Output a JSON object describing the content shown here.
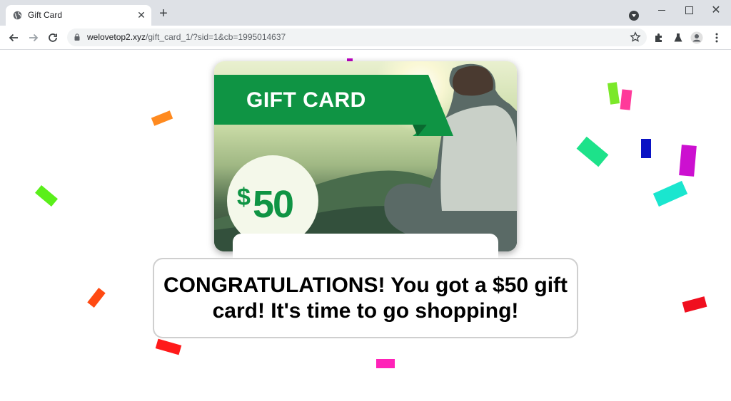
{
  "browser": {
    "tab_title": "Gift Card",
    "url_domain": "welovetop2.xyz",
    "url_path": "/gift_card_1/?sid=1&cb=1995014637"
  },
  "icons": {
    "favicon": "globe-icon",
    "tab_close": "close-icon",
    "new_tab": "plus-icon",
    "tab_search": "chevron-down-icon",
    "back": "arrow-left-icon",
    "forward": "arrow-right-icon",
    "reload": "reload-icon",
    "lock": "lock-icon",
    "bookmark": "star-icon",
    "extensions": "puzzle-icon",
    "labs": "flask-icon",
    "profile": "person-icon",
    "menu": "kebab-menu-icon"
  },
  "gift_card": {
    "banner_text": "GIFT CARD",
    "currency_symbol": "$",
    "amount": "50",
    "brand_green": "#0f9444"
  },
  "message": {
    "text": "CONGRATULATIONS! You got a $50 gift card! It's time to go shopping!"
  },
  "confetti_colors": [
    "#ff8a1f",
    "#5aef1a",
    "#ff4a12",
    "#ff1a1a",
    "#ff22b8",
    "#bc00c2",
    "#7be829",
    "#ff3a9a",
    "#1de28a",
    "#0a12c4",
    "#cc10d0",
    "#1ae6cf",
    "#f00f1f"
  ]
}
